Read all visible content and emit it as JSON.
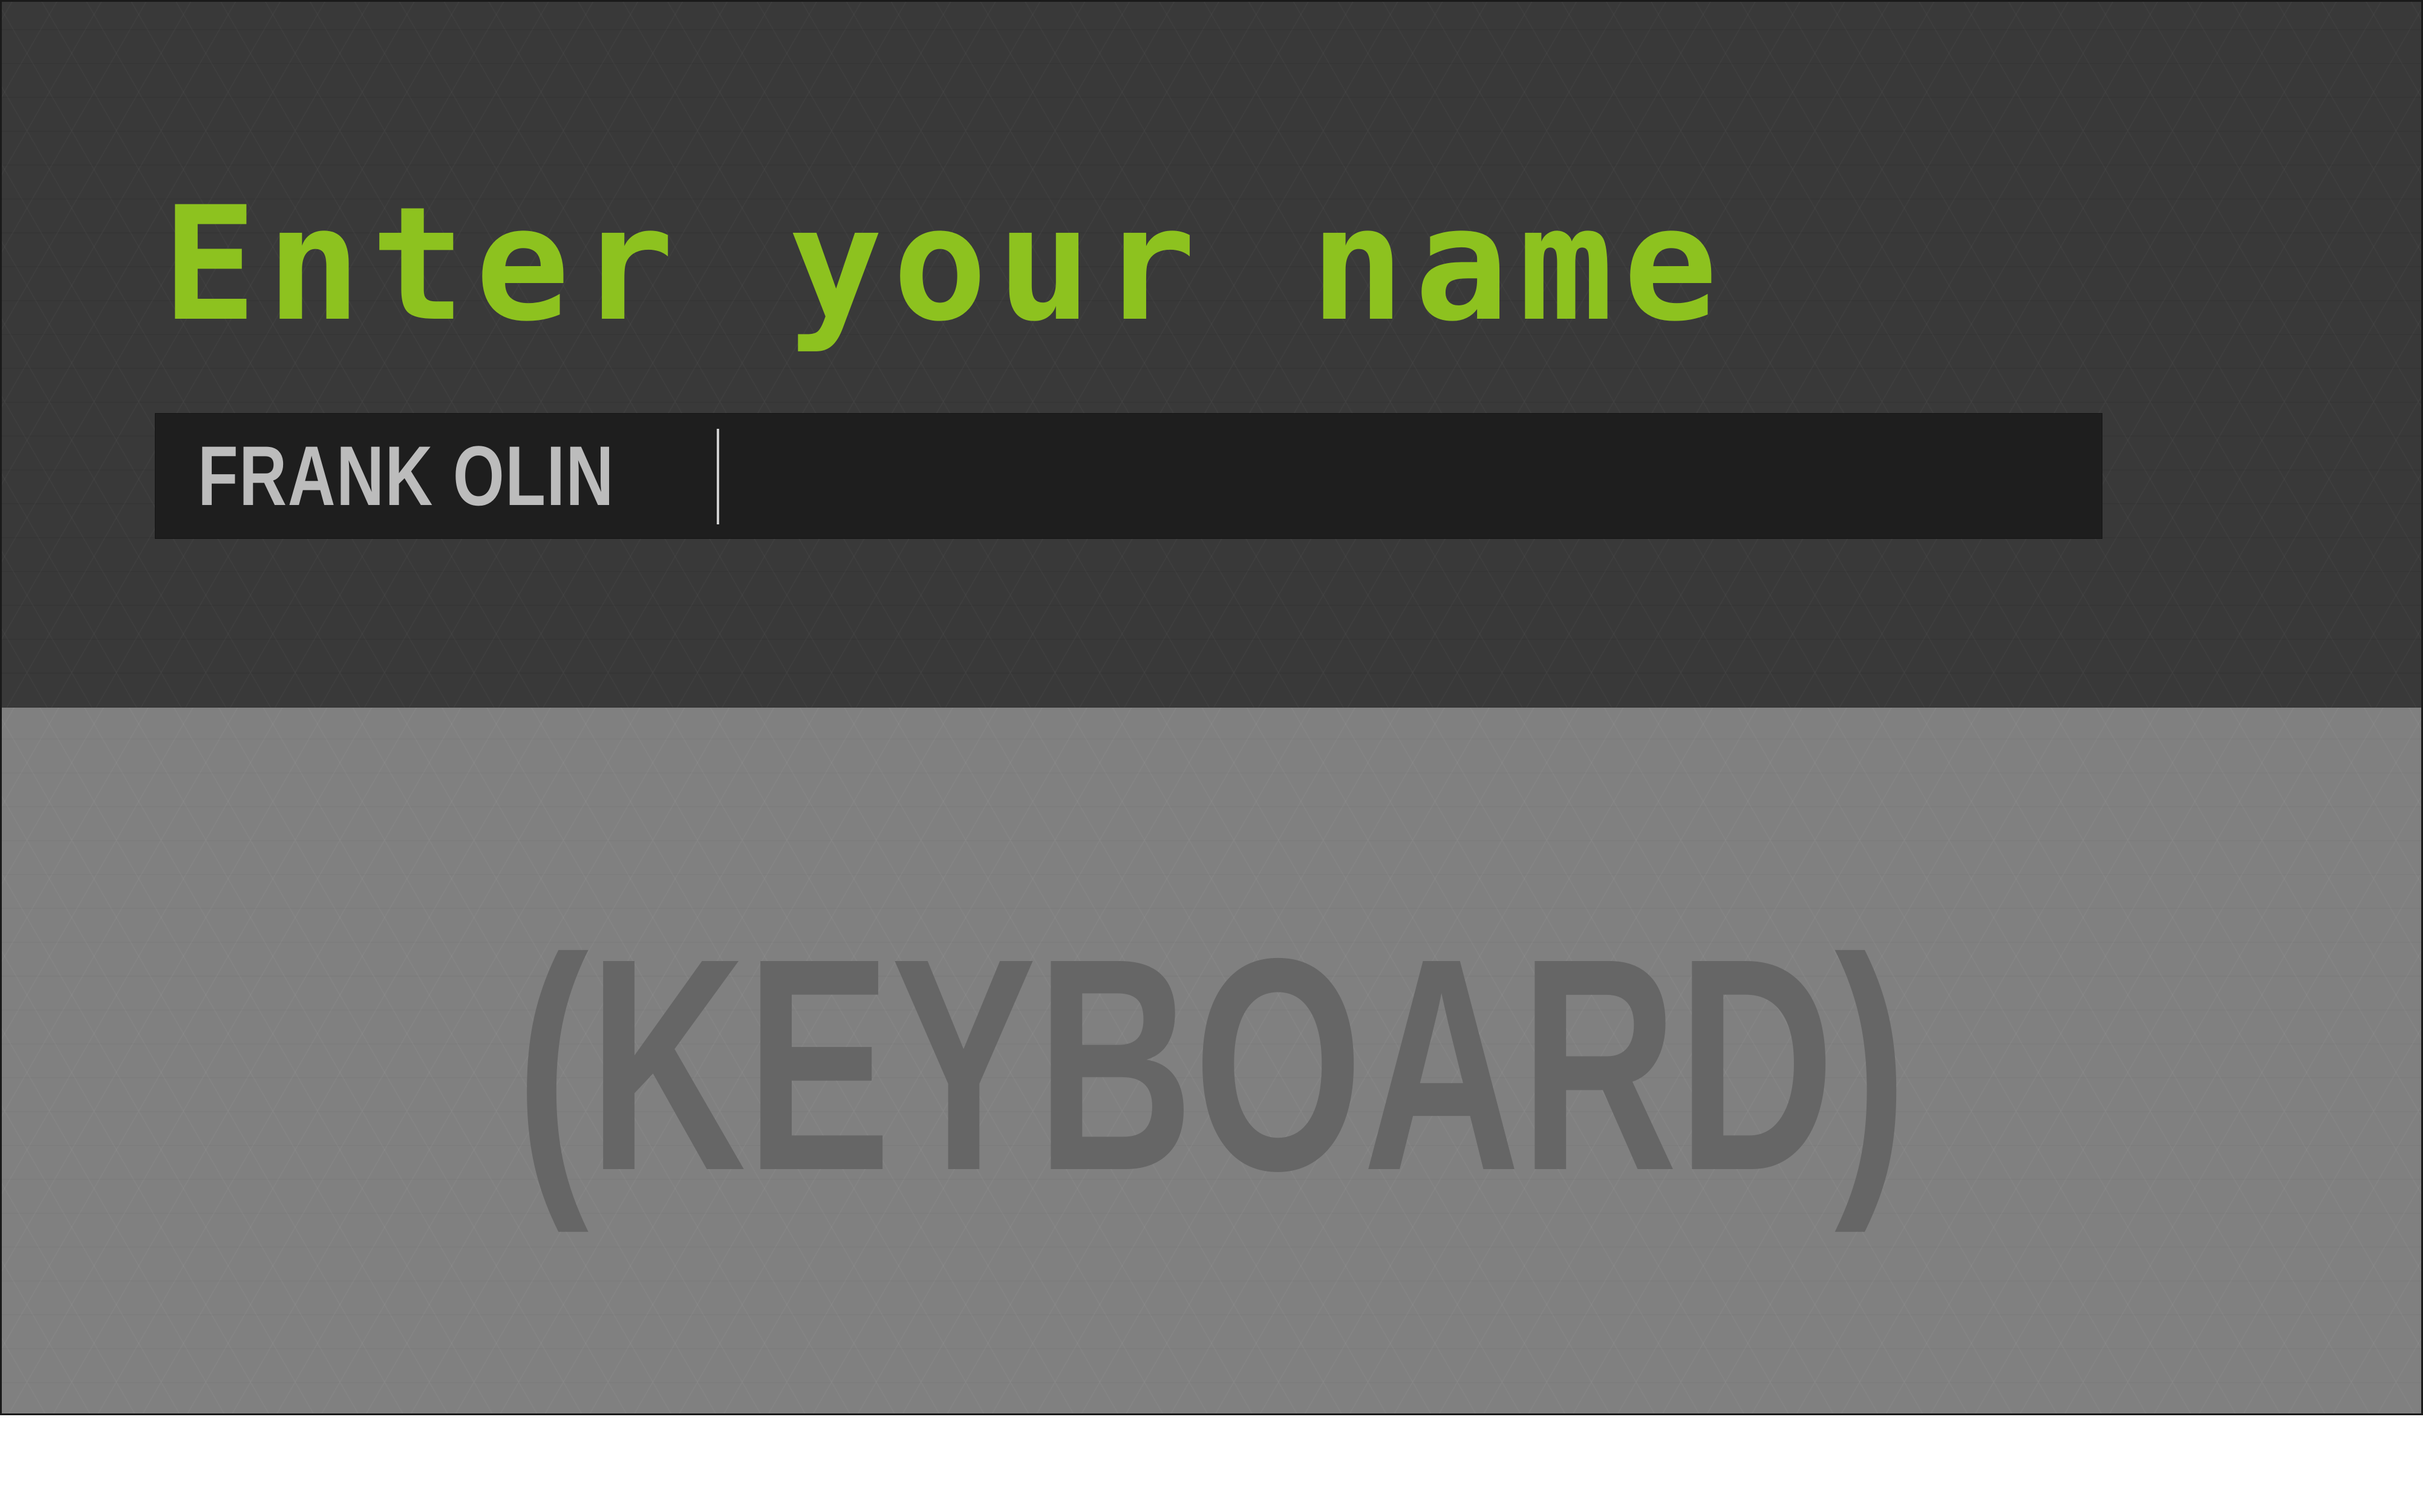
{
  "screen": {
    "heading": "Enter your name",
    "name_input": {
      "value": "FRANK OLIN"
    },
    "keyboard": {
      "placeholder_label": "(KEYBOARD)"
    }
  },
  "colors": {
    "accent": "#8dc21f",
    "top_background": "#393939",
    "input_background": "#1e1e1e",
    "input_text": "#bcbcbc",
    "keyboard_background": "#808080",
    "keyboard_label": "#666666"
  }
}
